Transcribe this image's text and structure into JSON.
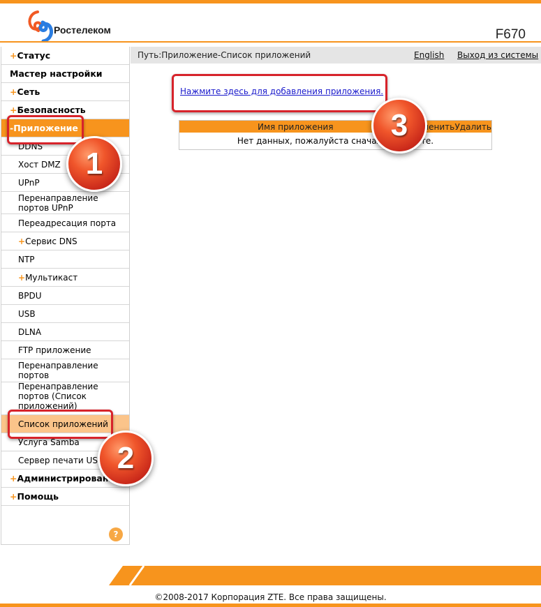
{
  "header": {
    "brand": "Ростелеком",
    "model": "F670"
  },
  "pathbar": {
    "path": "Путь:Приложение-Список приложений",
    "english": "English",
    "logout": "Выход из системы"
  },
  "sidebar": {
    "items": [
      {
        "label": "Статус",
        "plus": "+"
      },
      {
        "label": "Мастер настройки"
      },
      {
        "label": "Сеть",
        "plus": "+"
      },
      {
        "label": "Безопасность",
        "plus": "+"
      },
      {
        "label": "Приложение",
        "plus": "-"
      },
      {
        "label": "DDNS"
      },
      {
        "label": "Хост DMZ"
      },
      {
        "label": "UPnP"
      },
      {
        "label": "Перенаправление портов UPnP"
      },
      {
        "label": "Переадресация порта"
      },
      {
        "label": "Сервис DNS",
        "plus": "+"
      },
      {
        "label": "NTP"
      },
      {
        "label": "Мультикаст",
        "plus": "+"
      },
      {
        "label": "BPDU"
      },
      {
        "label": "USB"
      },
      {
        "label": "DLNA"
      },
      {
        "label": "FTP приложение"
      },
      {
        "label": "Перенаправление портов"
      },
      {
        "label": "Перенаправление портов (Список приложений)"
      },
      {
        "label": "Список приложений"
      },
      {
        "label": "Услуга Samba"
      },
      {
        "label": "Сервер печати USB"
      },
      {
        "label": "Администрирование",
        "plus": "+"
      },
      {
        "label": "Помощь",
        "plus": "+"
      }
    ],
    "help_symbol": "?"
  },
  "main": {
    "add_link": "Нажмите здесь для добавления приложения.",
    "table": {
      "headers": [
        "Имя приложения",
        "Изменить",
        "Удалить"
      ],
      "empty_text": "Нет данных, пожалуйста сначала добавьте."
    }
  },
  "badges": [
    "1",
    "2",
    "3"
  ],
  "footer": {
    "copyright": "©2008-2017 Корпорация ZTE. Все права защищены."
  },
  "colors": {
    "accent": "#f7941d",
    "active_child": "#fbc48a",
    "callout": "#d7232b",
    "link": "#1a1acc"
  }
}
